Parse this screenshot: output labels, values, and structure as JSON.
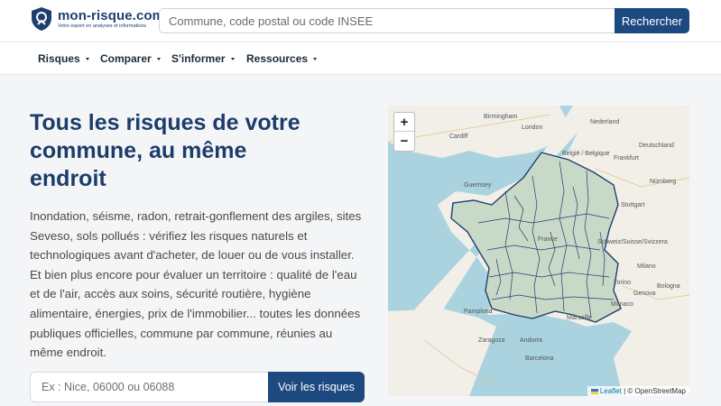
{
  "header": {
    "logo_name": "mon-risque.com",
    "logo_tagline": "Votre expert en analyses et informations",
    "search_placeholder": "Commune, code postal ou code INSEE",
    "search_button": "Rechercher"
  },
  "nav": {
    "items": [
      {
        "label": "Risques"
      },
      {
        "label": "Comparer"
      },
      {
        "label": "S'informer"
      },
      {
        "label": "Ressources"
      }
    ]
  },
  "hero": {
    "title": "Tous les risques de votre commune, au même endroit",
    "text": "Inondation, séisme, radon, retrait-gonflement des argiles, sites Seveso, sols pollués : vérifiez les risques naturels et technologiques avant d'acheter, de louer ou de vous installer. Et bien plus encore pour évaluer un territoire : qualité de l'eau et de l'air, accès aux soins, sécurité routière, hygiène alimentaire, énergies, prix de l'immobilier... toutes les données publiques officielles, commune par commune, réunies au même endroit.",
    "cta_placeholder": "Ex : Nice, 06000 ou 06088",
    "cta_button": "Voir les risques"
  },
  "map": {
    "zoom_in": "+",
    "zoom_out": "−",
    "attribution_leaflet": "Leaflet",
    "attribution_rest": "| © OpenStreetMap",
    "labels": {
      "birmingham": "Birmingham",
      "london": "London",
      "cardiff": "Cardiff",
      "nederland": "Nederland",
      "belgique": "België / Belgique",
      "deutschland": "Deutschland",
      "frankfurt": "Frankfurt",
      "nurnberg": "Nürnberg",
      "stuttgart": "Stuttgart",
      "guernsey": "Guernsey",
      "schweiz": "Schweiz/Suisse/Svizzera",
      "milano": "Milano",
      "torino": "Torino",
      "monaco": "Monaco",
      "genova": "Genova",
      "bologna": "Bologna",
      "marseille": "Marseille",
      "pamplona": "Pamplona",
      "zaragoza": "Zaragoza",
      "barcelona": "Barcelona",
      "andorra": "Andorra",
      "france": "France"
    },
    "colors": {
      "sea": "#aad3df",
      "land": "#f2efe9",
      "france_fill": "#c9d9c8",
      "borders": "#1f3f6e"
    }
  }
}
